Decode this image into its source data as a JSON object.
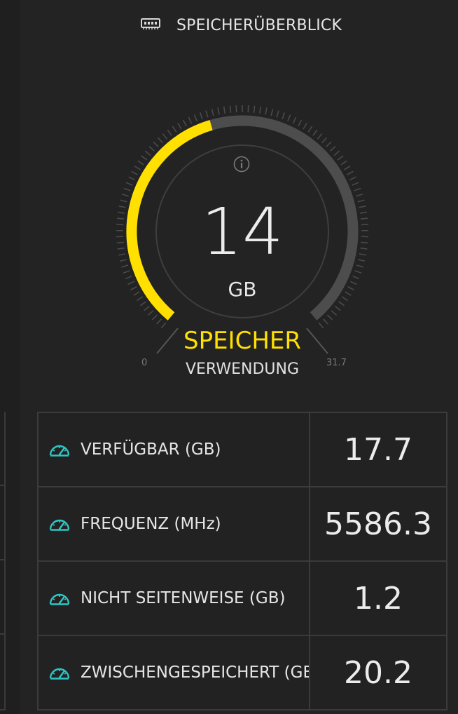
{
  "header": {
    "icon": "memory-module-icon",
    "title": "SPEICHERÜBERBLICK"
  },
  "gauge": {
    "value": "14",
    "unit": "GB",
    "label": "SPEICHER",
    "sublabel": "VERWENDUNG",
    "min_label": "0",
    "max_label": "31.7",
    "min": 0,
    "max": 31.7,
    "current": 14,
    "accent_color": "#ffe000",
    "track_color": "#4d4d4d"
  },
  "stats": {
    "icon_color": "#2fc6c6",
    "rows": [
      {
        "icon": "speedometer-icon",
        "label": "VERFÜGBAR (GB)",
        "value": "17.7"
      },
      {
        "icon": "speedometer-icon",
        "label": "FREQUENZ (MHz)",
        "value": "5586.3"
      },
      {
        "icon": "speedometer-icon",
        "label": "NICHT SEITENWEISE (GB)",
        "value": "1.2"
      },
      {
        "icon": "speedometer-icon",
        "label": "ZWISCHENGESPEICHERT (GB)",
        "value": "20.2"
      }
    ]
  }
}
